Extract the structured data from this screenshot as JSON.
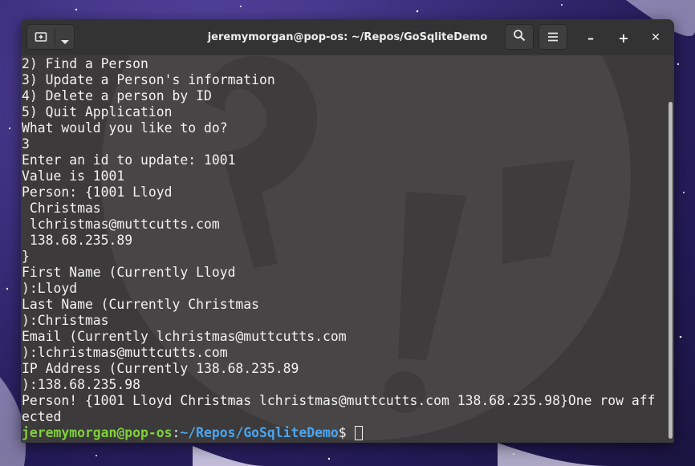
{
  "window": {
    "title": "jeremymorgan@pop-os: ~/Repos/GoSqliteDemo",
    "minimize_label": "–",
    "maximize_label": "+",
    "close_label": "✕"
  },
  "icons": {
    "new_tab": "new-tab-icon",
    "dropdown": "chevron-down-icon",
    "search": "search-icon",
    "menu": "hamburger-menu-icon"
  },
  "terminal": {
    "lines": [
      "2) Find a Person",
      "3) Update a Person's information",
      "4) Delete a person by ID",
      "5) Quit Application",
      "What would you like to do?",
      "3",
      "Enter an id to update: 1001",
      "Value is 1001",
      "Person: {1001 Lloyd",
      " Christmas",
      " lchristmas@muttcutts.com",
      " 138.68.235.89",
      "}",
      "First Name (Currently Lloyd",
      "):Lloyd",
      "Last Name (Currently Christmas",
      "):Christmas",
      "Email (Currently lchristmas@muttcutts.com",
      "):lchristmas@muttcutts.com",
      "IP Address (Currently 138.68.235.89",
      "):138.68.235.98",
      "Person! {1001 Lloyd Christmas lchristmas@muttcutts.com 138.68.235.98}One row aff",
      "ected"
    ],
    "prompt": {
      "user_host": "jeremymorgan@pop-os",
      "separator": ":",
      "path": "~/Repos/GoSqliteDemo",
      "symbol": "$ "
    }
  },
  "colors": {
    "prompt_user": "#7fd13b",
    "prompt_path": "#4aa5f0",
    "terminal_bg": "#3c3a3b",
    "titlebar_bg": "#333333"
  }
}
